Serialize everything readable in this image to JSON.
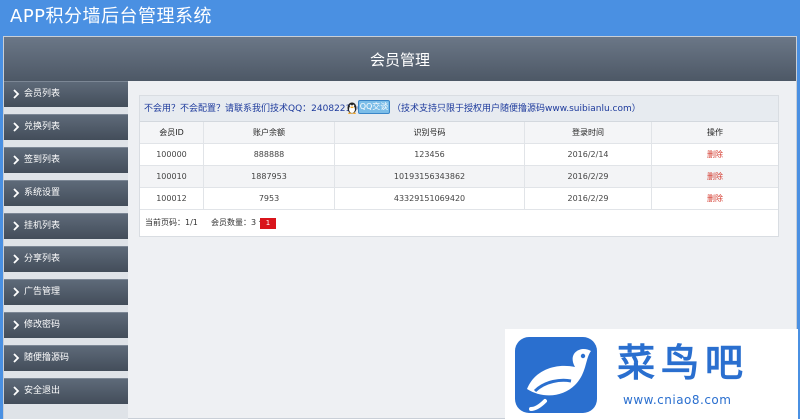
{
  "app": {
    "title": "APP积分墙后台管理系统"
  },
  "page": {
    "title": "会员管理"
  },
  "sidebar": {
    "items": [
      {
        "label": "会员列表"
      },
      {
        "label": "兑换列表"
      },
      {
        "label": "签到列表"
      },
      {
        "label": "系统设置"
      },
      {
        "label": "挂机列表"
      },
      {
        "label": "分享列表"
      },
      {
        "label": "广告管理"
      },
      {
        "label": "修改密码"
      },
      {
        "label": "随便撸源码"
      },
      {
        "label": "安全退出"
      }
    ]
  },
  "notice": {
    "text_before": "不会用？不会配置？请联系我们技术QQ：2408221403",
    "qq_button": "QQ交谈",
    "text_after": "（技术支持只限于授权用户随便撸源码www.suibianlu.com）"
  },
  "table": {
    "columns": [
      "会员ID",
      "账户余额",
      "识别号码",
      "登录时间",
      "操作"
    ],
    "rows": [
      {
        "id": "100000",
        "balance": "888888",
        "code": "123456",
        "login": "2016/2/14",
        "action": "删除"
      },
      {
        "id": "100010",
        "balance": "1887953",
        "code": "10193156343862",
        "login": "2016/2/29",
        "action": "删除"
      },
      {
        "id": "100012",
        "balance": "7953",
        "code": "43329151069420",
        "login": "2016/2/29",
        "action": "删除"
      }
    ]
  },
  "pager": {
    "page_info": "当前页码：1/1",
    "count_info": "会员数量：3 个",
    "current_page": "1"
  },
  "watermark": {
    "brand_cn": "菜鸟吧",
    "url": "www.cniao8.com"
  },
  "colors": {
    "brand_blue": "#4a90e2",
    "header_dark": "#4d5866",
    "delete_red": "#d43a2e",
    "page_active": "#d9141b"
  }
}
